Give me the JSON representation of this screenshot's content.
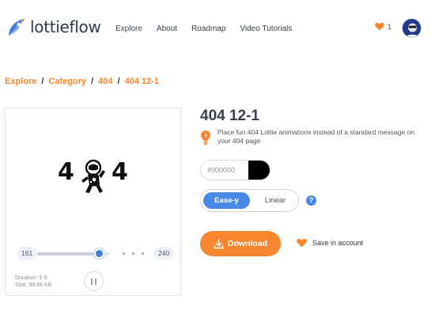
{
  "header": {
    "brand": "lottieflow",
    "nav": [
      "Explore",
      "About",
      "Roadmap",
      "Video Tutorials"
    ],
    "likes_count": "1"
  },
  "breadcrumb": [
    "Explore",
    "Category",
    "404",
    "404 12-1"
  ],
  "preview": {
    "frame_start": "161",
    "frame_end": "240",
    "progress": 0.85,
    "duration": "Duration: 5 S",
    "size": "Size: 96.86 KB"
  },
  "details": {
    "title": "404 12-1",
    "tip": "Place fun 404 Lottie animations instead of a standard message on your 404 page",
    "color_value": "#000000",
    "swatch_color": "#000000",
    "easing_options": [
      "Ease-y",
      "Linear"
    ],
    "easing_selected": "Ease-y",
    "help": "?",
    "download_label": "Download",
    "save_label": "Save in account"
  },
  "colors": {
    "accent": "#f7862e",
    "primary": "#4a8ae6"
  }
}
